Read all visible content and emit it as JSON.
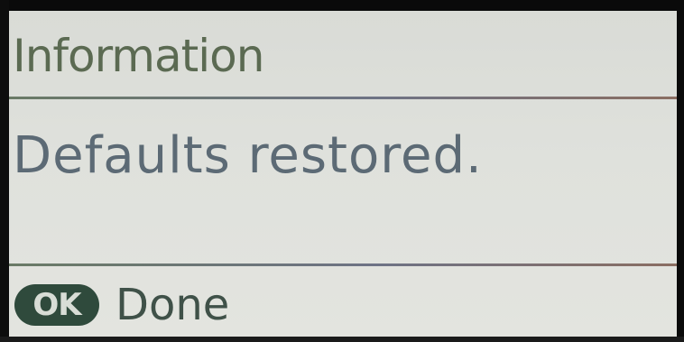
{
  "screen": {
    "title": "Information",
    "message": "Defaults restored.",
    "footer": {
      "ok_badge_label": "OK",
      "done_label": "Done"
    }
  },
  "colors": {
    "lcd_background": "#dfe1dc",
    "title_text": "#5b6a52",
    "message_text": "#5c6a75",
    "ok_badge": "#2f4a3c",
    "bezel": "#0a0a0a"
  }
}
